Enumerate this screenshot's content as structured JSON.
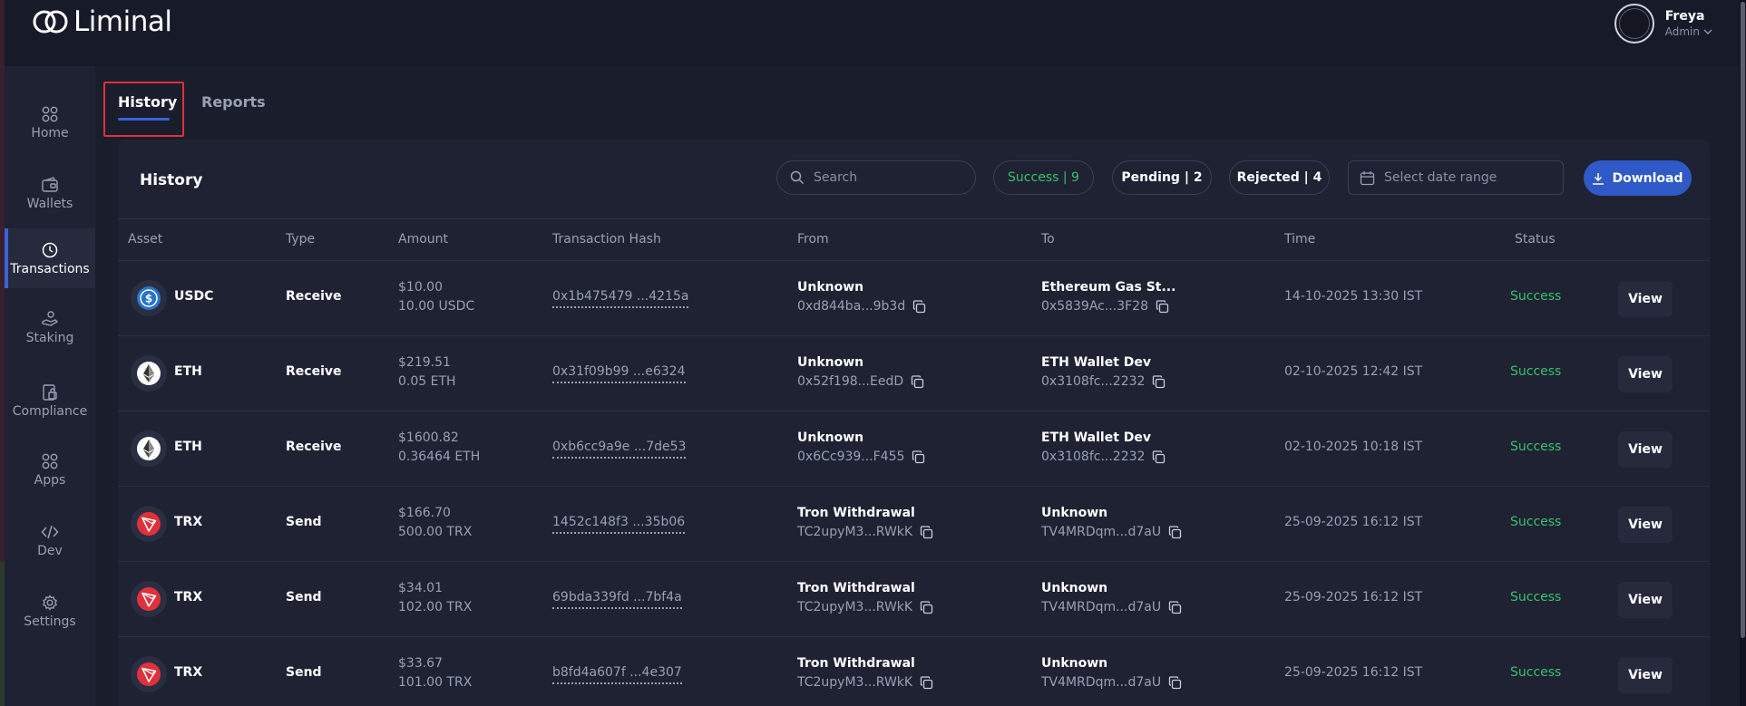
{
  "app": {
    "name": "Liminal"
  },
  "user": {
    "name": "Freya",
    "role": "Admin"
  },
  "sidebar": {
    "items": [
      {
        "label": "Home",
        "icon": "home-icon",
        "active": false
      },
      {
        "label": "Wallets",
        "icon": "wallet-icon",
        "active": false
      },
      {
        "label": "Transactions",
        "icon": "clock-icon",
        "active": true
      },
      {
        "label": "Staking",
        "icon": "staking-icon",
        "active": false
      },
      {
        "label": "Compliance",
        "icon": "compliance-icon",
        "active": false
      },
      {
        "label": "Apps",
        "icon": "apps-icon",
        "active": false
      },
      {
        "label": "Dev",
        "icon": "code-icon",
        "active": false
      },
      {
        "label": "Settings",
        "icon": "gear-icon",
        "active": false
      }
    ]
  },
  "tabs": [
    {
      "label": "History",
      "active": true
    },
    {
      "label": "Reports",
      "active": false
    }
  ],
  "panel": {
    "title": "History",
    "search_placeholder": "Search",
    "filters": {
      "success": "Success | 9",
      "pending": "Pending | 2",
      "rejected": "Rejected | 4"
    },
    "date_placeholder": "Select date range",
    "download_label": "Download"
  },
  "columns": [
    "Asset",
    "Type",
    "Amount",
    "Transaction Hash",
    "From",
    "To",
    "Time",
    "Status"
  ],
  "transactions": [
    {
      "asset": "USDC",
      "type": "Receive",
      "amount_usd": "$10.00",
      "amount_token": "10.00 USDC",
      "hash": "0x1b475479 ...4215a",
      "from_name": "Unknown",
      "from_addr": "0xd844ba...9b3d",
      "to_name": "Ethereum Gas St...",
      "to_addr": "0x5839Ac...3F28",
      "time": "14-10-2025 13:30 IST",
      "status": "Success",
      "action": "View"
    },
    {
      "asset": "ETH",
      "type": "Receive",
      "amount_usd": "$219.51",
      "amount_token": "0.05 ETH",
      "hash": "0x31f09b99 ...e6324",
      "from_name": "Unknown",
      "from_addr": "0x52f198...EedD",
      "to_name": "ETH Wallet Dev",
      "to_addr": "0x3108fc...2232",
      "time": "02-10-2025 12:42 IST",
      "status": "Success",
      "action": "View"
    },
    {
      "asset": "ETH",
      "type": "Receive",
      "amount_usd": "$1600.82",
      "amount_token": "0.36464 ETH",
      "hash": "0xb6cc9a9e ...7de53",
      "from_name": "Unknown",
      "from_addr": "0x6Cc939...F455",
      "to_name": "ETH Wallet Dev",
      "to_addr": "0x3108fc...2232",
      "time": "02-10-2025 10:18 IST",
      "status": "Success",
      "action": "View"
    },
    {
      "asset": "TRX",
      "type": "Send",
      "amount_usd": "$166.70",
      "amount_token": "500.00 TRX",
      "hash": "1452c148f3 ...35b06",
      "from_name": "Tron Withdrawal",
      "from_addr": "TC2upyM3...RWkK",
      "to_name": "Unknown",
      "to_addr": "TV4MRDqm...d7aU",
      "time": "25-09-2025 16:12 IST",
      "status": "Success",
      "action": "View"
    },
    {
      "asset": "TRX",
      "type": "Send",
      "amount_usd": "$34.01",
      "amount_token": "102.00 TRX",
      "hash": "69bda339fd ...7bf4a",
      "from_name": "Tron Withdrawal",
      "from_addr": "TC2upyM3...RWkK",
      "to_name": "Unknown",
      "to_addr": "TV4MRDqm...d7aU",
      "time": "25-09-2025 16:12 IST",
      "status": "Success",
      "action": "View"
    },
    {
      "asset": "TRX",
      "type": "Send",
      "amount_usd": "$33.67",
      "amount_token": "101.00 TRX",
      "hash": "b8fd4a607f ...4e307",
      "from_name": "Tron Withdrawal",
      "from_addr": "TC2upyM3...RWkK",
      "to_name": "Unknown",
      "to_addr": "TV4MRDqm...d7aU",
      "time": "25-09-2025 16:12 IST",
      "status": "Success",
      "action": "View"
    }
  ],
  "colors": {
    "accent": "#2f59c6",
    "success": "#3ac06a",
    "highlight": "#e0313b",
    "usdc": "#2775ca",
    "trx": "#e0313b"
  }
}
